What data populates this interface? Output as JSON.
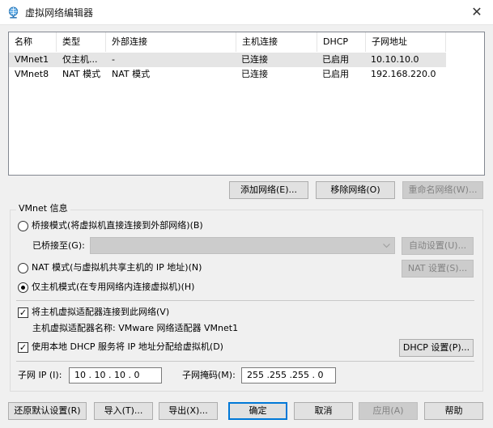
{
  "window": {
    "title": "虚拟网络编辑器",
    "close_glyph": "✕"
  },
  "table": {
    "columns": [
      "名称",
      "类型",
      "外部连接",
      "主机连接",
      "DHCP",
      "子网地址"
    ],
    "rows": [
      [
        "VMnet1",
        "仅主机...",
        "-",
        "已连接",
        "已启用",
        "10.10.10.0"
      ],
      [
        "VMnet8",
        "NAT 模式",
        "NAT 模式",
        "已连接",
        "已启用",
        "192.168.220.0"
      ]
    ],
    "selected_row": 0
  },
  "table_buttons": {
    "add": "添加网络(E)...",
    "remove": "移除网络(O)",
    "rename": "重命名网络(W)..."
  },
  "vmnet": {
    "group_label": "VMnet 信息",
    "bridge_radio": "桥接模式(将虚拟机直接连接到外部网络)(B)",
    "bridged_to_label": "已桥接至(G):",
    "bridged_to_value": "",
    "auto_settings": "自动设置(U)...",
    "nat_radio": "NAT 模式(与虚拟机共享主机的 IP 地址)(N)",
    "nat_settings": "NAT 设置(S)...",
    "hostonly_radio": "仅主机模式(在专用网络内连接虚拟机)(H)",
    "selected_mode": "hostonly",
    "connect_adapter": "将主机虚拟适配器连接到此网络(V)",
    "connect_adapter_checked": true,
    "adapter_name": "主机虚拟适配器名称: VMware 网络适配器 VMnet1",
    "use_dhcp": "使用本地 DHCP 服务将 IP 地址分配给虚拟机(D)",
    "use_dhcp_checked": true,
    "dhcp_settings": "DHCP 设置(P)...",
    "subnet_ip_label": "子网 IP (I):",
    "subnet_ip": "10 . 10 . 10 . 0",
    "subnet_mask_label": "子网掩码(M):",
    "subnet_mask": "255 .255 .255 . 0"
  },
  "footer": {
    "restore": "还原默认设置(R)",
    "import": "导入(T)...",
    "export": "导出(X)...",
    "ok": "确定",
    "cancel": "取消",
    "apply": "应用(A)",
    "help": "帮助"
  },
  "colors": {
    "accent": "#0078d7",
    "selection": "#e5e5e5",
    "disabled_text": "#838383"
  },
  "icons": {
    "app": "network-globe-icon",
    "close": "close-icon",
    "dropdown": "chevron-down-icon"
  }
}
